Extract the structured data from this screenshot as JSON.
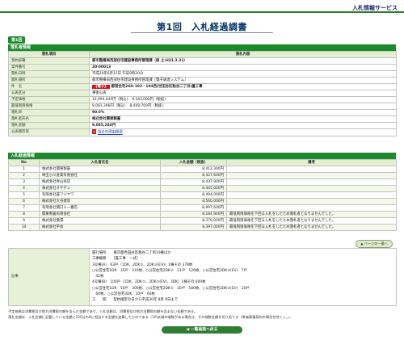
{
  "header": {
    "service_name": "入札情報サービス",
    "page_title": "第1回　入札経過調書"
  },
  "round_tab": "第1回",
  "bid_info": {
    "section_title": "落札者情報",
    "col_item": "落札項目",
    "col_content": "落札内容",
    "rows": [
      {
        "label": "契約部署",
        "value": "都市整備局西部住宅建設事務所管理課（局 止:H31.3.31）",
        "bold": true
      },
      {
        "label": "案件番号",
        "value": "30-00013",
        "bold": true
      },
      {
        "label": "開札日時",
        "value": "平成30年6月12日 午前9時20分",
        "bold": false
      },
      {
        "label": "開札場所",
        "value": "都市整備局西部住宅建設事務所管理課［電子調達システム］",
        "bold": false
      },
      {
        "label": "件　名",
        "tag": "【電子】",
        "value": "都営住宅26H-103・104西(世田谷区粕谷二丁目)畳工事",
        "bold": true
      },
      {
        "label": "公表区分",
        "value": "事後公表",
        "bold": false
      },
      {
        "label": "予定価格",
        "value": "10,090,440円（税込）　9,343,000円（税抜）",
        "bold": false
      },
      {
        "label": "最低制限価格",
        "value": "9,081,396円（税込）　8,408,700円（税抜）",
        "bold": false
      },
      {
        "label": "落札率",
        "value": "90.0%",
        "bold": true
      },
      {
        "label": "落札者氏名",
        "value": "株式会社関東製畳",
        "bold": true
      },
      {
        "label": "落札金額",
        "value": "9,085,284円",
        "bold": true
      },
      {
        "label": "公表資料等",
        "icon": "pdf-icon",
        "value": "指名の理由概要",
        "bold": false
      }
    ]
  },
  "bid_list": {
    "section_title": "入札経過情報",
    "columns": [
      "No",
      "入札者氏名",
      "入札金額（税抜）",
      "備考"
    ],
    "rows": [
      {
        "no": "1",
        "name": "株式会社関東製畳",
        "amount": "8,412,300円",
        "note": ""
      },
      {
        "no": "2",
        "name": "埼玉小川産業有限会社",
        "amount": "8,427,600円",
        "note": ""
      },
      {
        "no": "3",
        "name": "株式会社青山商店",
        "amount": "8,437,900円",
        "note": ""
      },
      {
        "no": "4",
        "name": "株式会社オサゲン",
        "amount": "8,445,000円",
        "note": ""
      },
      {
        "no": "5",
        "name": "有限会社畳フジヤワ",
        "amount": "8,494,000円",
        "note": ""
      },
      {
        "no": "6",
        "name": "株式会社大谷建装",
        "amount": "8,560,000円",
        "note": ""
      },
      {
        "no": "7",
        "name": "有限会社関口十一番店",
        "amount": "8,997,600円",
        "note": ""
      },
      {
        "no": "8",
        "name": "関東製畳有限会社",
        "amount": "8,184,900円",
        "note": "最低制限価格を下回る入札をしたため落札者となりませんでした。"
      },
      {
        "no": "9",
        "name": "株式会社藁澤",
        "amount": "8,379,000円",
        "note": "最低制限価格を下回る入札をしたため落札者となりませんでした。"
      },
      {
        "no": "10",
        "name": "株式会社平会",
        "amount": "8,397,000円",
        "note": "最低制限価格を下回る入札をしたため落札者となりませんでした。"
      }
    ]
  },
  "page_top_button": "ページの一番へ",
  "remarks": {
    "label": "記事",
    "lines": [
      "履行場所　　東京都世田谷区粕谷二丁目19番ほか",
      "工事概要　　［畳工事　一式］",
      "3号棟(A)　63戸（1DK、2DK②、2DK③(EV)）1棟その 378枚",
      "○公営住宅1DK　35戸　210枚、○公営住宅2DK②　21戸　126枚、○公営住宅2DK③(EV)　7戸",
      "　42枚",
      "4号棟(B)　100戸（1DK、2DK②、2DK③(EV)、3DK）1棟その 600枚",
      "○公営住宅1DK　50戸　300枚、○公営住宅2DK②　30戸　180枚、○公営住宅2DK③(EV)　10戸",
      "　60枚、○公営住宅3DK　10戸　60枚",
      "工　　期　　契約確定の日から平成30年 8月 9日まで"
    ]
  },
  "footnotes": [
    "予定価格は消費税及び地方消費税の額を含んだ金額であり、入札金額は、消費税及び地方消費税の額を含まない金額である。",
    "落札金額は、入札金額に記載している金額に100分の8に相当する金額を加算したものである（1円未満の端数がある場合は、その端数金額を切り捨てる（単価事業契約の場合を除く。）。）。"
  ],
  "back_button": "一覧画面へ戻る",
  "colors": {
    "accent_green": "#1b8a2a",
    "label_bg": "#e7f1d6",
    "title_navy": "#003366",
    "tag_red": "#d11717"
  }
}
